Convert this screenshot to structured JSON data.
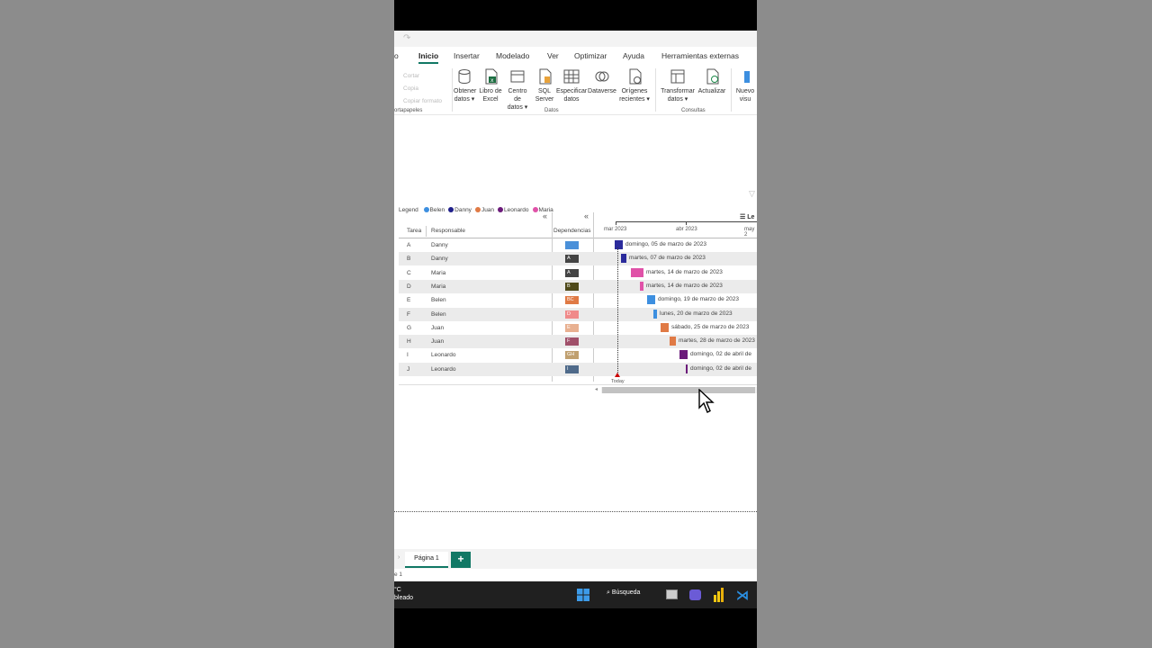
{
  "title_bar": {
    "redo_icon": "redo-icon"
  },
  "menu": {
    "items": [
      "o",
      "Inicio",
      "Insertar",
      "Modelado",
      "Ver",
      "Optimizar",
      "Ayuda",
      "Herramientas externas"
    ],
    "active": "Inicio"
  },
  "ribbon": {
    "clipboard": {
      "cut": "Cortar",
      "copy": "Copia",
      "format": "Copiar formato",
      "group": "ortapapeles"
    },
    "buttons": [
      {
        "l1": "Obtener",
        "l2": "datos ▾"
      },
      {
        "l1": "Libro de",
        "l2": "Excel"
      },
      {
        "l1": "Centro de",
        "l2": "datos ▾"
      },
      {
        "l1": "SQL",
        "l2": "Server"
      },
      {
        "l1": "Especificar",
        "l2": "datos"
      },
      {
        "l1": "Dataverse",
        "l2": ""
      },
      {
        "l1": "Orígenes",
        "l2": "recientes ▾"
      },
      {
        "l1": "Transformar",
        "l2": "datos ▾"
      },
      {
        "l1": "Actualizar",
        "l2": ""
      },
      {
        "l1": "Nuevo",
        "l2": "visu"
      }
    ],
    "groups": {
      "datos": "Datos",
      "consultas": "Consultas"
    },
    "colors": {
      "excel": "#1d6f42",
      "accent": "#117865"
    }
  },
  "legend": {
    "label": "Legend",
    "items": [
      {
        "name": "Belen",
        "color": "#3d8fe0"
      },
      {
        "name": "Danny",
        "color": "#1f1f8a"
      },
      {
        "name": "Juan",
        "color": "#e07a45"
      },
      {
        "name": "Leonardo",
        "color": "#6b1a7a"
      },
      {
        "name": "Maria",
        "color": "#e052a8"
      }
    ]
  },
  "table": {
    "headers": {
      "task": "Tarea",
      "responsible": "Responsable",
      "deps": "Dependencias"
    },
    "rows": [
      {
        "task": "A",
        "resp": "Danny",
        "dep": "",
        "dep_color": "#4a90d9",
        "label": "domingo, 05 de marzo de 2023",
        "color": "#2b2b9c"
      },
      {
        "task": "B",
        "resp": "Danny",
        "dep": "A",
        "dep_color": "#444444",
        "label": "martes, 07 de marzo de 2023",
        "color": "#2b2b9c"
      },
      {
        "task": "C",
        "resp": "Maria",
        "dep": "A",
        "dep_color": "#444444",
        "label": "martes, 14 de marzo de 2023",
        "color": "#e052a8"
      },
      {
        "task": "D",
        "resp": "Maria",
        "dep": "B",
        "dep_color": "#4f4a1a",
        "label": "martes, 14 de marzo de 2023",
        "color": "#e052a8"
      },
      {
        "task": "E",
        "resp": "Belen",
        "dep": "BC",
        "dep_color": "#e07a45",
        "label": "domingo, 19 de marzo de 2023",
        "color": "#3d8fe0"
      },
      {
        "task": "F",
        "resp": "Belen",
        "dep": "D",
        "dep_color": "#f08a8a",
        "label": "lunes, 20 de marzo de 2023",
        "color": "#3d8fe0"
      },
      {
        "task": "G",
        "resp": "Juan",
        "dep": "E",
        "dep_color": "#e8b090",
        "label": "sábado, 25 de marzo de 2023",
        "color": "#e07a45"
      },
      {
        "task": "H",
        "resp": "Juan",
        "dep": "F",
        "dep_color": "#a0506a",
        "label": "martes, 28 de marzo de 2023",
        "color": "#e07a45"
      },
      {
        "task": "I",
        "resp": "Leonardo",
        "dep": "GH",
        "dep_color": "#c0a070",
        "label": "domingo, 02 de abril de",
        "color": "#6b1a7a"
      },
      {
        "task": "J",
        "resp": "Leonardo",
        "dep": "I",
        "dep_color": "#4f6a8a",
        "label": "domingo, 02 de abril de",
        "color": "#6b1a7a"
      }
    ]
  },
  "timeline": {
    "months": [
      "mar 2023",
      "abr 2023",
      "may 2"
    ],
    "today": "Today",
    "legend_toggle": "Le"
  },
  "pages": {
    "tab": "Página 1",
    "add": "+"
  },
  "status": {
    "page": "e 1"
  },
  "taskbar": {
    "weather_temp": "°C",
    "weather_text": "bleado",
    "search": "Búsqueda"
  }
}
